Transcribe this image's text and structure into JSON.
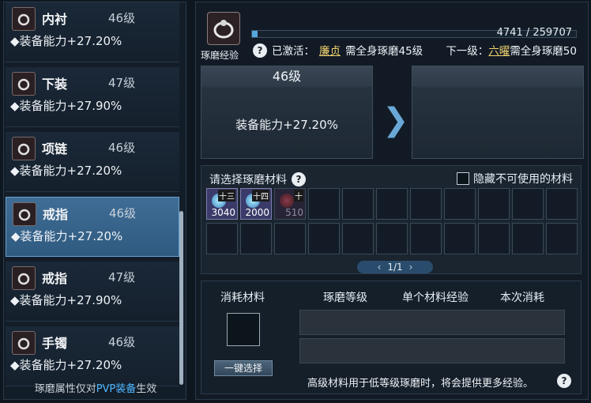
{
  "left_panel": {
    "items": [
      {
        "name": "内衬",
        "level": "46级",
        "bonus": "◆装备能力+27.20%",
        "icon": "shirt-icon"
      },
      {
        "name": "下装",
        "level": "47级",
        "bonus": "◆装备能力+27.90%",
        "icon": "pants-icon"
      },
      {
        "name": "项链",
        "level": "46级",
        "bonus": "◆装备能力+27.20%",
        "icon": "necklace-icon"
      },
      {
        "name": "戒指",
        "level": "46级",
        "bonus": "◆装备能力+27.20%",
        "icon": "ring-icon",
        "selected": true
      },
      {
        "name": "戒指",
        "level": "47级",
        "bonus": "◆装备能力+27.90%",
        "icon": "ring-icon"
      },
      {
        "name": "手镯",
        "level": "46级",
        "bonus": "◆装备能力+27.20%",
        "icon": "bracelet-icon"
      }
    ],
    "footer_prefix": "琢磨属性仅对",
    "footer_pvp": "PVP装备",
    "footer_suffix": "生效"
  },
  "header": {
    "label": "琢磨经验",
    "exp_text": "4741 / 259707",
    "exp_progress": 0.018,
    "active_prefix": "已激活：",
    "active_link": "廉贞",
    "active_desc": "需全身琢磨45级",
    "next_prefix": "下一级：",
    "next_link": "六曜",
    "next_desc": "需全身琢磨50"
  },
  "current_level": {
    "title": "46级",
    "bonus": "装备能力+27.20%"
  },
  "materials": {
    "title": "请选择琢磨材料",
    "hide_label": "隐藏不可使用的材料",
    "page": "1/1",
    "slots": [
      {
        "tag": "十三",
        "count": "3040"
      },
      {
        "tag": "十四",
        "count": "2000"
      },
      {
        "tag": "十",
        "count": "510",
        "dim": true
      }
    ]
  },
  "consume": {
    "col_material": "消耗材料",
    "col_level": "琢磨等级",
    "col_exp": "单个材料经验",
    "col_cost": "本次消耗",
    "select_btn": "一键选择",
    "tip": "高级材料用于低等级琢磨时，将会提供更多经验。"
  },
  "colors": {
    "accent": "#55a8dd",
    "link": "#f2d470",
    "pvp": "#4fb8ff"
  }
}
